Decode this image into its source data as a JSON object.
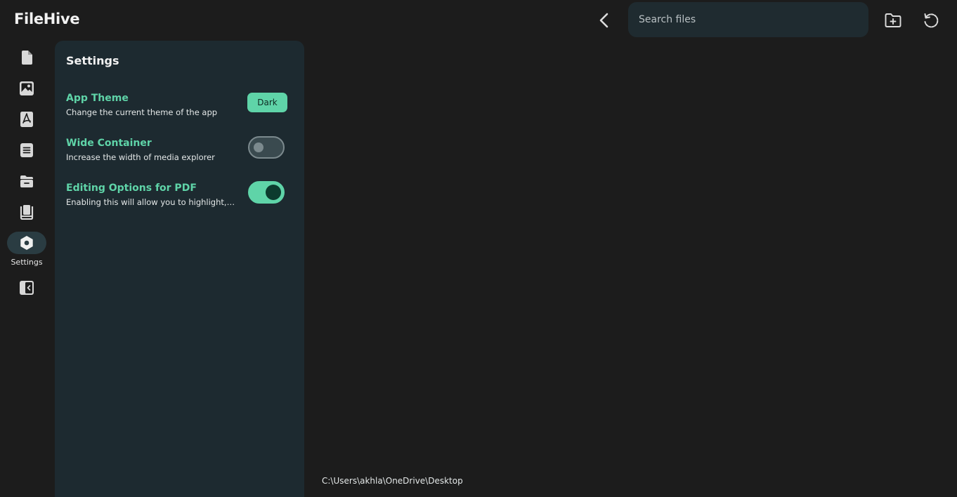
{
  "app": {
    "title": "FileHive"
  },
  "topbar": {
    "back_icon": "chevron-left-icon",
    "search_placeholder": "Search files",
    "search_value": "",
    "new_folder_icon": "folder-plus-icon",
    "refresh_icon": "refresh-icon"
  },
  "sidebar": {
    "items": [
      {
        "icon": "document-icon",
        "label": ""
      },
      {
        "icon": "image-icon",
        "label": ""
      },
      {
        "icon": "pdf-icon",
        "label": ""
      },
      {
        "icon": "text-file-icon",
        "label": ""
      },
      {
        "icon": "archive-icon",
        "label": ""
      },
      {
        "icon": "book-icon",
        "label": ""
      },
      {
        "icon": "settings-icon",
        "label": "Settings",
        "active": true
      },
      {
        "icon": "collapse-sidebar-icon",
        "label": ""
      }
    ]
  },
  "settings": {
    "title": "Settings",
    "items": [
      {
        "title": "App Theme",
        "description": "Change the current theme of the app",
        "control": "button",
        "value": "Dark"
      },
      {
        "title": "Wide Container",
        "description": "Increase the width of media explorer",
        "control": "toggle",
        "enabled": false
      },
      {
        "title": "Editing Options for PDF",
        "description": "Enabling this will allow you to highlight, ...",
        "control": "toggle",
        "enabled": true
      }
    ]
  },
  "status": {
    "path": "C:\\Users\\akhla\\OneDrive\\Desktop"
  },
  "colors": {
    "background": "#1c1c1c",
    "panel": "#1d2a30",
    "accent": "#5fd4a8",
    "search_bg": "#1f2b30",
    "active_nav": "#2a3c42"
  }
}
